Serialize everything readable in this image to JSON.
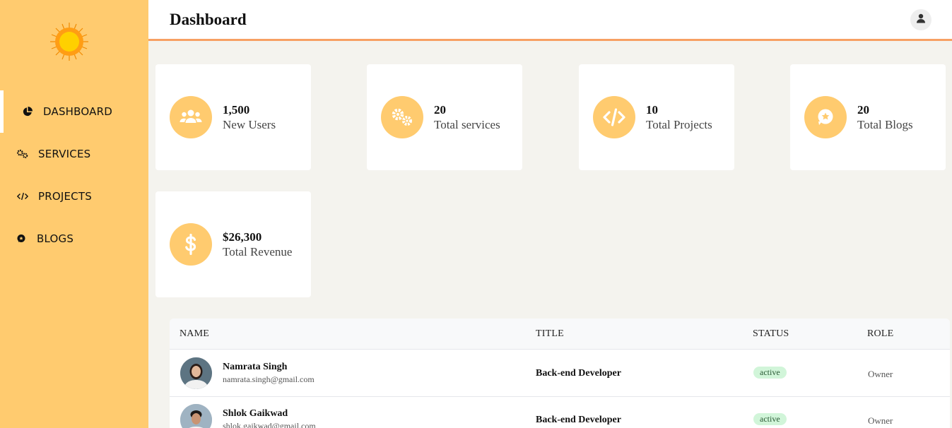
{
  "header": {
    "title": "Dashboard"
  },
  "sidebar": {
    "items": [
      {
        "label": "DASHBOARD",
        "icon": "pie-chart-icon"
      },
      {
        "label": "SERVICES",
        "icon": "gears-icon"
      },
      {
        "label": "PROJECTS",
        "icon": "code-icon"
      },
      {
        "label": "BLOGS",
        "icon": "comment-star-icon"
      }
    ]
  },
  "stats": [
    {
      "value": "1,500",
      "label": "New Users",
      "icon": "users-icon"
    },
    {
      "value": "20",
      "label": "Total services",
      "icon": "gears-icon"
    },
    {
      "value": "10",
      "label": "Total Projects",
      "icon": "code-icon"
    },
    {
      "value": "20",
      "label": "Total Blogs",
      "icon": "comment-star-icon"
    },
    {
      "value": "$26,300",
      "label": "Total Revenue",
      "icon": "dollar-icon"
    }
  ],
  "table": {
    "headers": [
      "NAME",
      "TITLE",
      "STATUS",
      "ROLE"
    ],
    "rows": [
      {
        "name": "Namrata Singh",
        "email": "namrata.singh@gmail.com",
        "title": "Back-end Developer",
        "status": "active",
        "role": "Owner"
      },
      {
        "name": "Shlok Gaikwad",
        "email": "shlok.gaikwad@gmail.com",
        "title": "Back-end Developer",
        "status": "active",
        "role": "Owner"
      }
    ]
  },
  "colors": {
    "accent": "#ffcb6f",
    "border_accent": "#f7a063",
    "background": "#f4f3ee"
  }
}
